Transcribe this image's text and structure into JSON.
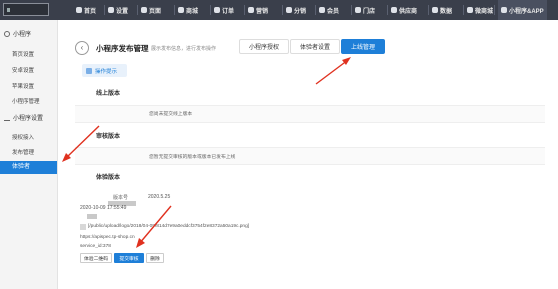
{
  "topnav": {
    "items": [
      {
        "label": "首页",
        "icon": "home-icon"
      },
      {
        "label": "设置",
        "icon": "gear-icon"
      },
      {
        "label": "页面",
        "icon": "page-icon"
      },
      {
        "label": "商城",
        "icon": "shop-icon"
      },
      {
        "label": "订单",
        "icon": "order-icon"
      },
      {
        "label": "营销",
        "icon": "marketing-icon"
      },
      {
        "label": "分销",
        "icon": "distribution-icon"
      },
      {
        "label": "会员",
        "icon": "member-icon"
      },
      {
        "label": "门店",
        "icon": "store-icon"
      },
      {
        "label": "供应商",
        "icon": "supplier-icon"
      },
      {
        "label": "数据",
        "icon": "data-icon"
      },
      {
        "label": "微商城",
        "icon": "microshop-icon"
      },
      {
        "label": "小程序&APP",
        "icon": "miniapp-icon"
      }
    ]
  },
  "sidebar": {
    "group1": "小程序",
    "group1_items": [
      "首页设置",
      "安卓设置",
      "苹果设置",
      "小程序管理"
    ],
    "group2": "小程序设置",
    "group2_items": [
      "授权接入",
      "发布管理"
    ],
    "active": "体验者"
  },
  "header": {
    "back": "‹",
    "title": "小程序发布管理",
    "subtitle": "展示发布信息，进行发布操作",
    "tabs": [
      "小程序授权",
      "体验者设置",
      "上线管理"
    ]
  },
  "hint": "操作提示",
  "sections": {
    "online": {
      "title": "线上版本",
      "text": "您尚未提交线上版本"
    },
    "review": {
      "title": "审核版本",
      "text": "您暂无提交审核的版本或版本已发布上线"
    },
    "trial": {
      "title": "体验版本"
    }
  },
  "trial": {
    "version_label": "版本号",
    "version": "2020.5.25",
    "datetime": "2020-10-09 17:55:49",
    "image_path": "[/public/upload/logo/2018/04-09/814d7e9a0eddcf3754f2e8372a50a19c.png]",
    "url": "https://apispec.tp-shop.cn",
    "service_id": "service_id:378"
  },
  "buttons": {
    "qrcode": "体验二维码",
    "submit": "提交审核",
    "delete": "删除"
  },
  "colors": {
    "accent": "#1e7fd8",
    "topbar": "#3a3f4b",
    "arrow": "#e0311f"
  }
}
